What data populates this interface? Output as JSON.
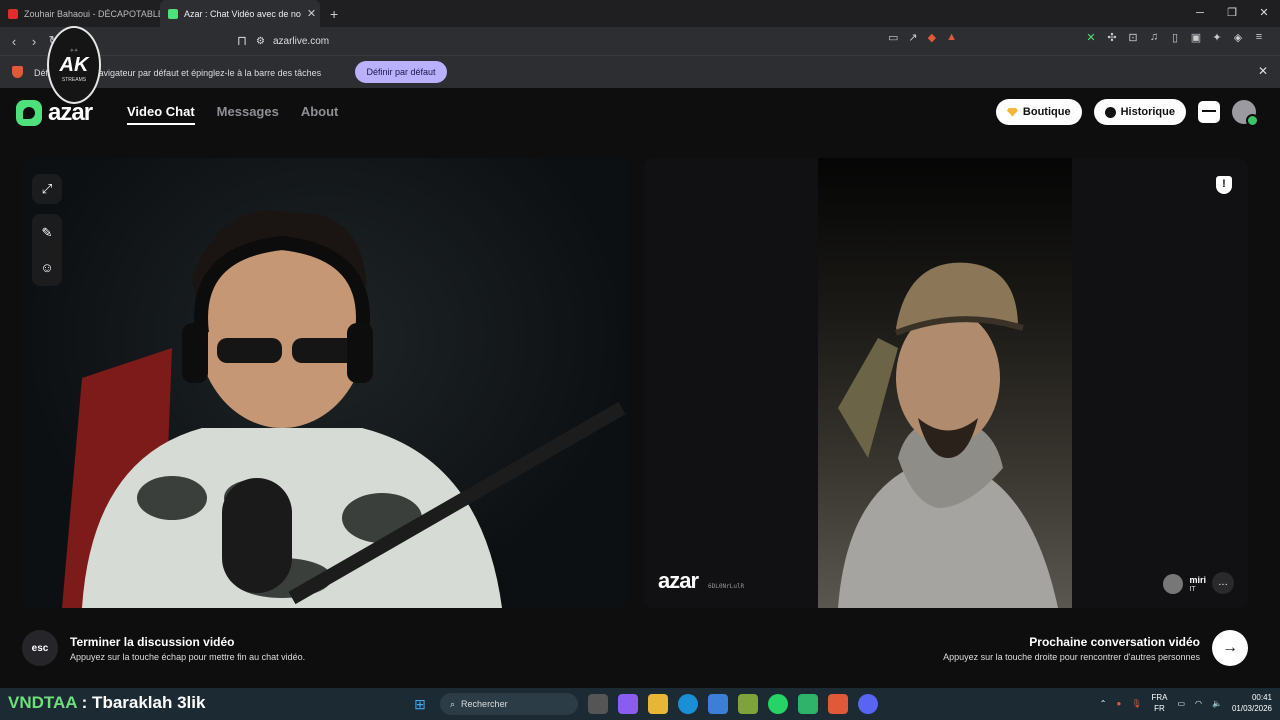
{
  "browser": {
    "tabs": [
      {
        "label": "Zouhair Bahaoui - DÉCAPOTABLE",
        "active": false
      },
      {
        "label": "Azar : Chat Vidéo avec de no",
        "active": true
      }
    ],
    "new_tab": "+",
    "url": "azarlive.com",
    "infobar": {
      "text": "Défi… comme navigateur par défaut et épinglez-le à la barre des tâches",
      "button": "Définir par défaut"
    }
  },
  "overlay_logo": {
    "big": "AK",
    "small": "STREAMS"
  },
  "app": {
    "brand": "azar",
    "nav": [
      "Video Chat",
      "Messages",
      "About"
    ],
    "active_nav": "Video Chat",
    "header_buttons": {
      "shop": "Boutique",
      "history": "Historique"
    },
    "watermark": "azar",
    "watermark_id": "6DL0NrLulR",
    "peer": {
      "name": "miri",
      "country": "IT"
    },
    "end_chat": {
      "key": "esc",
      "title": "Terminer la discussion vidéo",
      "hint": "Appuyez sur la touche échap pour mettre fin au chat vidéo."
    },
    "next_chat": {
      "title": "Prochaine conversation vidéo",
      "hint": "Appuyez sur la touche droite pour rencontrer d'autres personnes"
    }
  },
  "taskbar": {
    "overlay_text_a": "VNDTAA",
    "overlay_text_b": " : Tbaraklah 3lik",
    "search": "Rechercher",
    "lang_top": "FRA",
    "lang_bottom": "FR",
    "time": "00:41",
    "date": "01/03/2026"
  }
}
